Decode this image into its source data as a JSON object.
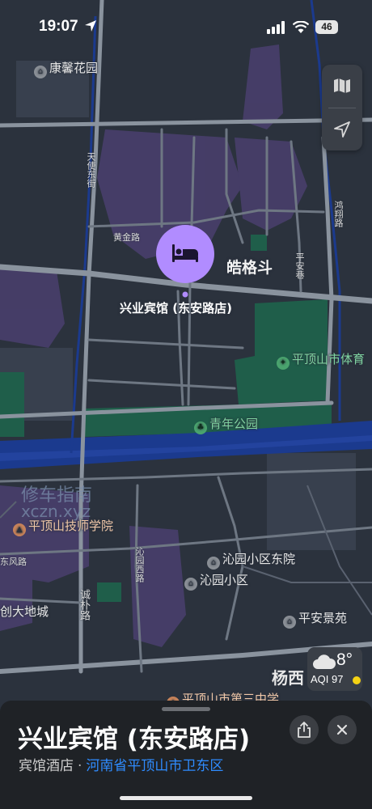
{
  "status_bar": {
    "time": "19:07",
    "battery": "46"
  },
  "map": {
    "district_label": "皓格斗",
    "selected_place_label": "兴业宾馆 (东安路店)",
    "pois": [
      {
        "name": "康馨花园",
        "icon": "building-icon"
      },
      {
        "name": "平顶山市体育",
        "icon": "park-icon"
      },
      {
        "name": "青年公园",
        "icon": "tree-icon"
      },
      {
        "name": "平顶山技师学院",
        "icon": "school-icon"
      },
      {
        "name": "沁园小区东院",
        "icon": "building-icon"
      },
      {
        "name": "沁园小区",
        "icon": "building-icon"
      },
      {
        "name": "平安景苑",
        "icon": "building-icon"
      },
      {
        "name": "平顶山市第三中学",
        "icon": "school-icon"
      }
    ],
    "streets": [
      "天使东街",
      "黄金路",
      "平安巷",
      "鸿翔路",
      "东风路",
      "沁园西路",
      "诚朴路"
    ],
    "partial_labels": {
      "mall": "创大地城",
      "east": "杨西",
      "watermark_1": "修车指南",
      "watermark_2": "xczn.xyz"
    }
  },
  "weather": {
    "temperature": "8°",
    "aqi": "AQI 97",
    "icon": "cloud-icon",
    "aqi_color": "#f5d314"
  },
  "place_card": {
    "title": "兴业宾馆 (东安路店)",
    "category": "宾馆酒店",
    "separator": "·",
    "address": "河南省平顶山市卫东区",
    "share_icon": "share-icon",
    "close_icon": "close-icon"
  },
  "colors": {
    "accent": "#b18cff",
    "link": "#2f8cff",
    "park": "#1f5e4a",
    "road": "#8a939e",
    "water": "#1b3a8e"
  }
}
